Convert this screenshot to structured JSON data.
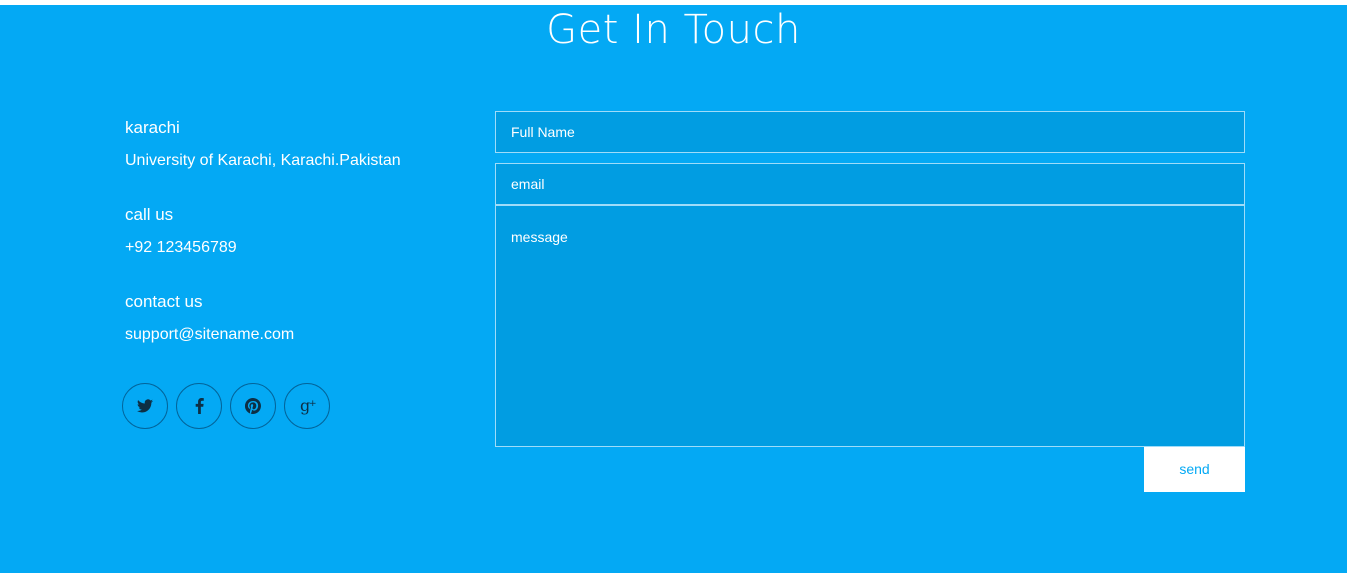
{
  "section": {
    "title": "Get In Touch",
    "background": "#04a9f4"
  },
  "contact": {
    "blocks": [
      {
        "heading": "karachi",
        "value": "University of Karachi, Karachi.Pakistan"
      },
      {
        "heading": "call us",
        "value": "+92 123456789"
      },
      {
        "heading": "contact us",
        "value": "support@sitename.com"
      }
    ],
    "socials": [
      {
        "icon": "twitter-icon"
      },
      {
        "icon": "facebook-icon"
      },
      {
        "icon": "pinterest-icon"
      },
      {
        "icon": "google-plus-icon"
      }
    ]
  },
  "form": {
    "name_placeholder": "Full Name",
    "email_placeholder": "email",
    "message_placeholder": "message",
    "send_label": "send"
  }
}
